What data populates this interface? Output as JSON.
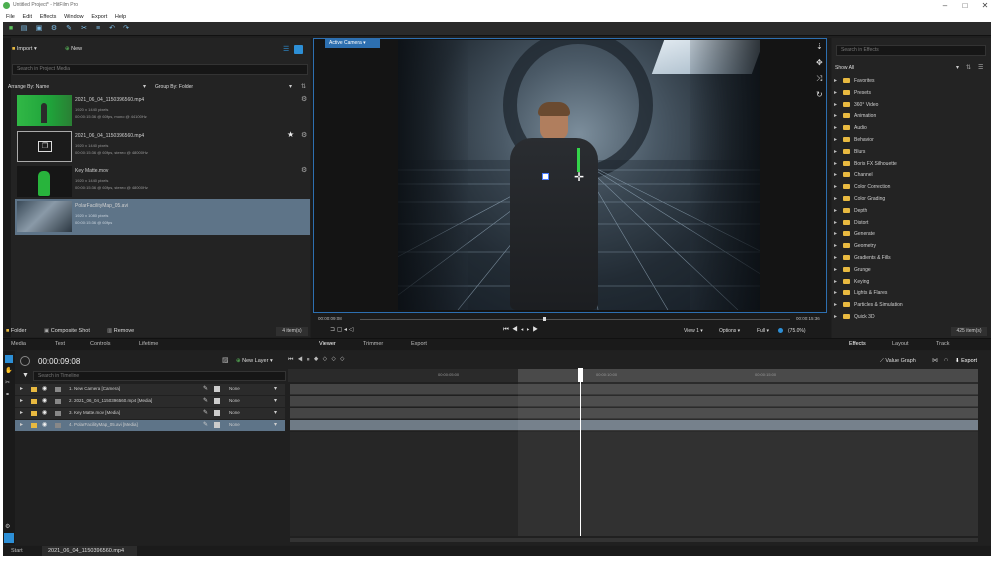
{
  "window": {
    "title": "Untitled Project* - HitFilm Pro"
  },
  "menu": [
    "File",
    "Edit",
    "Effects",
    "Window",
    "Export",
    "Help"
  ],
  "media_panel": {
    "import_label": "Import",
    "new_label": "New",
    "search_placeholder": "Search in Project Media",
    "arrange_label": "Arrange By: Name",
    "group_label": "Group By: Folder",
    "items": [
      {
        "name": "2021_06_04_1150396560.mp4",
        "line1": "1920 x 1440 pixels",
        "line2": "00:00:15:36 @ 60fps, mono @ 44100Hz"
      },
      {
        "name": "2021_06_04_1150396560.mp4",
        "line1": "1920 x 1440 pixels",
        "line2": "00:00:15:36 @ 60fps, stereo @ 48000Hz"
      },
      {
        "name": "Key Matte.mov",
        "line1": "1920 x 1440 pixels",
        "line2": "00:00:15:36 @ 60fps, stereo @ 48000Hz"
      },
      {
        "name": "PolarFacilityMap_05.avi",
        "line1": "1920 x 1080 pixels",
        "line2": "00:00:15:36 @ 60fps"
      }
    ],
    "folder_btn": "Folder",
    "composite_btn": "Composite Shot",
    "remove_btn": "Remove",
    "count": "4 item(s)",
    "tabs": [
      "Media",
      "Text",
      "Controls",
      "Lifetime"
    ]
  },
  "viewer": {
    "camera_label": "Active Camera",
    "timecode_left": "00:00:09:08",
    "timecode_right": "00:00:15:36",
    "view_label": "View 1",
    "options_label": "Options",
    "quality_label": "Full",
    "zoom_label": "(75.0%)",
    "tabs": [
      "Viewer",
      "Trimmer",
      "Export"
    ]
  },
  "effects_panel": {
    "search_placeholder": "Search in Effects",
    "show_label": "Show All",
    "categories": [
      "Favorites",
      "Presets",
      "360° Video",
      "Animation",
      "Audio",
      "Behavior",
      "Blurs",
      "Boris FX Silhouette",
      "Channel",
      "Color Correction",
      "Color Grading",
      "Depth",
      "Distort",
      "Generate",
      "Geometry",
      "Gradients & Fills",
      "Grunge",
      "Keying",
      "Lights & Flares",
      "Particles & Simulation",
      "Quick 3D"
    ],
    "count": "425 item(s)",
    "tabs": [
      "Effects",
      "Layout",
      "Track"
    ]
  },
  "timeline": {
    "timecode": "00:00:09:08",
    "new_layer_label": "New Layer",
    "search_placeholder": "Search in Timeline",
    "value_graph_label": "Value Graph",
    "export_label": "Export",
    "ruler": [
      "00:00:05:00",
      "00:00:10:00",
      "00:00:15:00"
    ],
    "layers": [
      {
        "label": "1. New Camera [Camera]",
        "blend": "None"
      },
      {
        "label": "2. 2021_06_04_1150396560.mp4 [Media]",
        "blend": "None"
      },
      {
        "label": "3. Key Matte.mov [Media]",
        "blend": "None"
      },
      {
        "label": "4. PolarFacilityMap_05.avi [Media]",
        "blend": "None"
      }
    ]
  },
  "bottom_tabs": [
    "Start",
    "2021_06_04_1150396560.mp4"
  ],
  "colors": {
    "accent": "#2d8fd6",
    "selection": "#5e7488",
    "folder": "#e8b940",
    "playhead": "#ffffff"
  }
}
